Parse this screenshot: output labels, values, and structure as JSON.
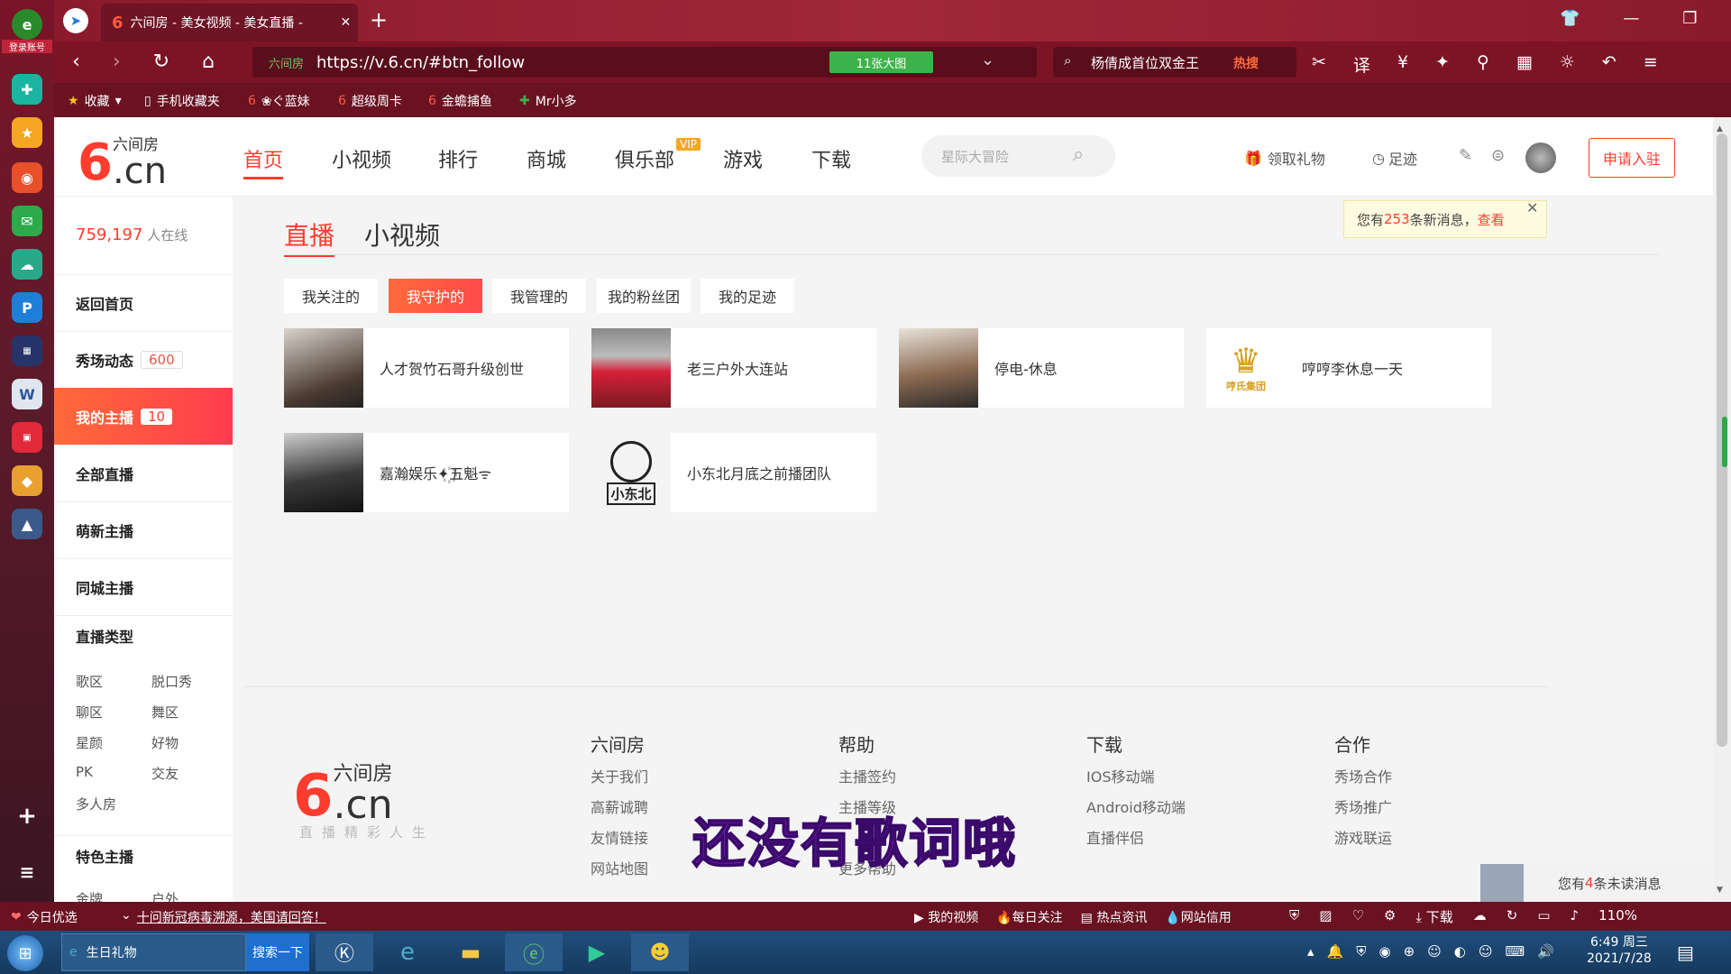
{
  "dock": {
    "login_label": "登录账号"
  },
  "browser": {
    "tab_title": "六间房 - 美女视频 - 美女直播 -",
    "url": "https://v.6.cn/#btn_follow",
    "url_site_tag": "六间房",
    "big_image_label": "11张大图",
    "search_value": "杨倩成首位双金王",
    "hot_label": "热搜"
  },
  "bookmarks": [
    "收藏",
    "手机收藏夹",
    "❀ぐ蓝妹",
    "超级周卡",
    "金蟾捕鱼",
    "Mr小多"
  ],
  "site": {
    "logo_text": "六间房",
    "logo_domain": ".cn",
    "nav": [
      "首页",
      "小视频",
      "排行",
      "商城",
      "俱乐部",
      "游戏",
      "下载"
    ],
    "vip": "VIP",
    "search_placeholder": "星际大冒险",
    "gift_label": "领取礼物",
    "footprint_label": "足迹",
    "apply_label": "申请入驻",
    "notice_prefix": "您有",
    "notice_count": "253",
    "notice_suffix": "条新消息，",
    "notice_link": "查看"
  },
  "sidebar": {
    "online_count": "759,197",
    "online_label": "人在线",
    "items": [
      {
        "label": "返回首页"
      },
      {
        "label": "秀场动态",
        "badge": "600"
      },
      {
        "label": "我的主播",
        "badge": "10"
      },
      {
        "label": "全部直播"
      },
      {
        "label": "萌新主播"
      },
      {
        "label": "同城主播"
      }
    ],
    "type_title": "直播类型",
    "types": [
      "歌区",
      "脱口秀",
      "聊区",
      "舞区",
      "星颜",
      "好物",
      "PK",
      "交友",
      "多人房"
    ],
    "special_title": "特色主播",
    "special_cut": [
      "金牌",
      "户外"
    ]
  },
  "main": {
    "tabs": [
      "直播",
      "小视频"
    ],
    "filters": [
      "我关注的",
      "我守护的",
      "我管理的",
      "我的粉丝团",
      "我的足迹"
    ],
    "anchors": [
      "人才贺竹石哥升级创世",
      "老三户外大连站",
      "停电-休息",
      "哼哼李休息一天",
      "嘉瀚娱乐✦꙰五魁ᯤ",
      "小东北月底之前播团队"
    ],
    "card_logo_text": "哼氏集团",
    "card_logo2_text": "小东北"
  },
  "footer": {
    "tagline": "直播精彩人生",
    "cols": [
      {
        "title": "六间房",
        "links": [
          "关于我们",
          "高薪诚聘",
          "友情链接",
          "网站地图"
        ]
      },
      {
        "title": "帮助",
        "links": [
          "主播签约",
          "主播等级",
          "",
          "更多帮助"
        ]
      },
      {
        "title": "下载",
        "links": [
          "IOS移动端",
          "Android移动端",
          "直播伴侣"
        ]
      },
      {
        "title": "合作",
        "links": [
          "秀场合作",
          "秀场推广",
          "游戏联运"
        ]
      }
    ],
    "lyric": "还没有歌词哦",
    "unread_prefix": "您有",
    "unread_count": "4",
    "unread_suffix": "条未读消息"
  },
  "statusbar": {
    "today": "今日优选",
    "news": "十问新冠病毒溯源，美国请回答！",
    "items": [
      "我的视频",
      "每日关注",
      "热点资讯",
      "网站信用",
      "下载"
    ],
    "zoom": "110%"
  },
  "taskbar": {
    "window_title": "生日礼物",
    "search_btn": "搜索一下",
    "time": "6:49 周三",
    "date": "2021/7/28"
  }
}
